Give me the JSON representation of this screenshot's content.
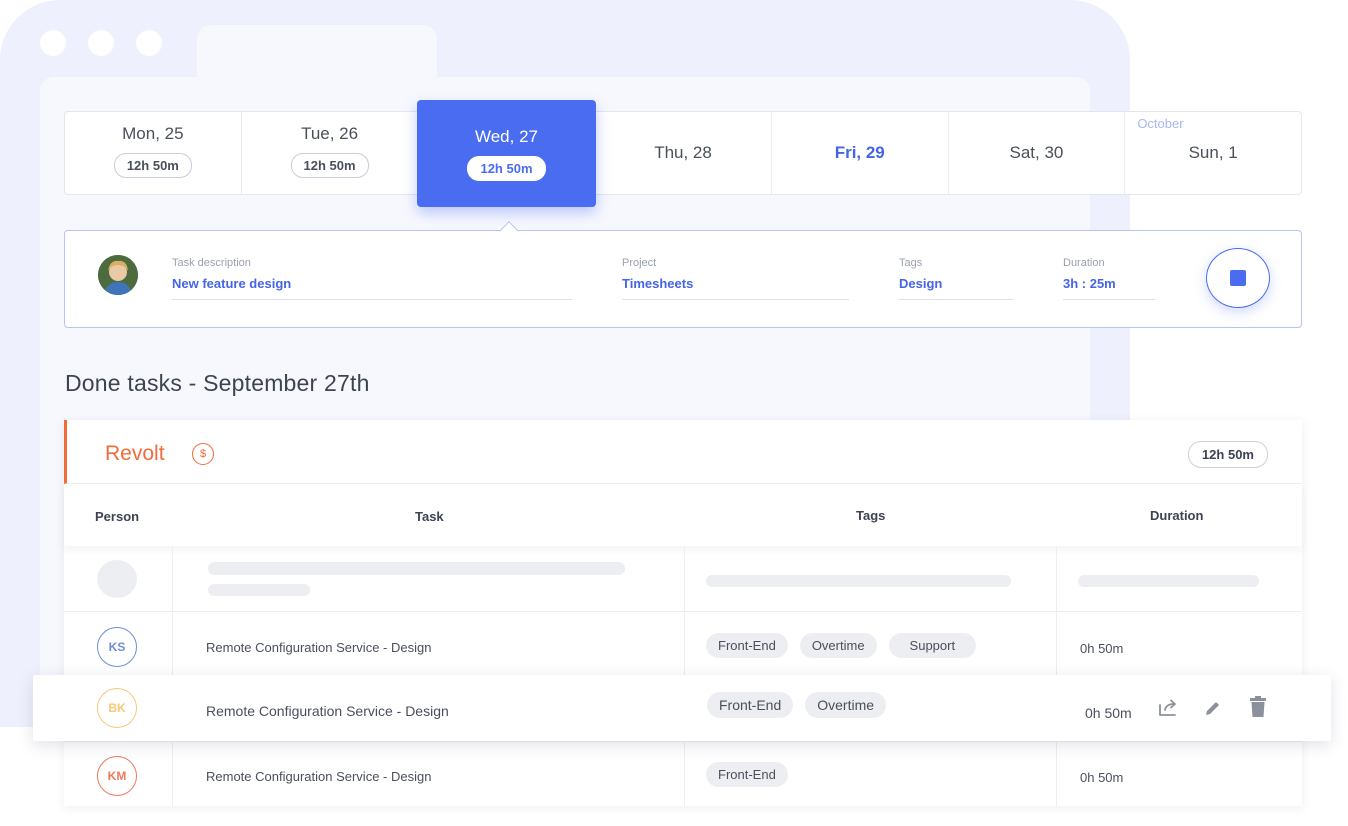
{
  "week": {
    "days": [
      {
        "label": "Mon, 25",
        "total": "12h 50m"
      },
      {
        "label": "Tue, 26",
        "total": "12h 50m"
      },
      {
        "label": "Wed, 27",
        "total": "12h 50m"
      },
      {
        "label": "Thu, 28"
      },
      {
        "label": "Fri, 29"
      },
      {
        "label": "Sat, 30"
      },
      {
        "label": "Sun, 1",
        "month": "October"
      }
    ]
  },
  "tracker": {
    "task_label": "Task description",
    "task_value": "New feature design",
    "project_label": "Project",
    "project_value": "Timesheets",
    "tags_label": "Tags",
    "tags_value": "Design",
    "duration_label": "Duration",
    "duration_value": "3h : 25m"
  },
  "section_title": "Done tasks - September 27th",
  "project": {
    "name": "Revolt",
    "billable_icon": "$",
    "total": "12h 50m"
  },
  "columns": {
    "person": "Person",
    "task": "Task",
    "tags": "Tags",
    "duration": "Duration"
  },
  "rows": [
    {
      "initials": "KS",
      "task": "Remote Configuration Service - Design",
      "tags": [
        "Front-End",
        "Overtime",
        "Support"
      ],
      "duration": "0h 50m"
    },
    {
      "initials": "BK",
      "task": "Remote Configuration Service - Design",
      "tags": [
        "Front-End",
        "Overtime"
      ],
      "duration": "0h 50m"
    },
    {
      "initials": "KM",
      "task": "Remote Configuration Service - Design",
      "tags": [
        "Front-End"
      ],
      "duration": "0h 50m"
    }
  ],
  "colors": {
    "accent": "#4a6cf0",
    "project": "#f26b3a",
    "ks": "#6b8fd8",
    "bk": "#f3c36a",
    "km": "#ee7a5a"
  },
  "icons": {
    "row_actions": [
      "share-icon",
      "pencil-icon",
      "trash-icon"
    ],
    "tracker": "stop-icon"
  }
}
